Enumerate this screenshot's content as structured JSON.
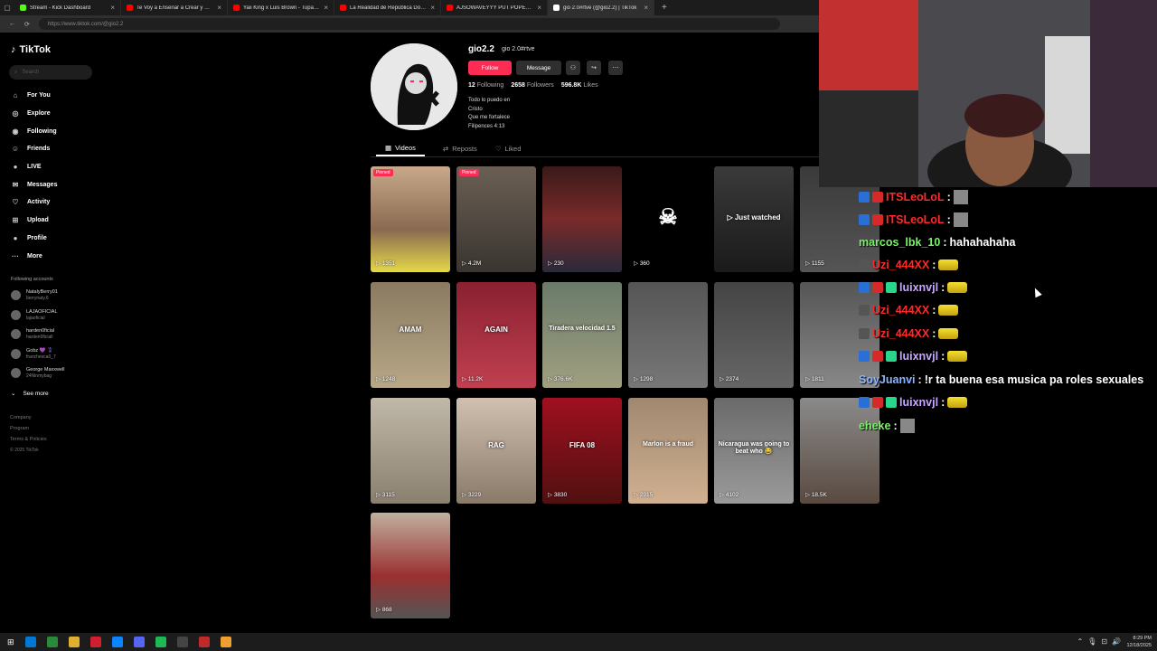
{
  "browser": {
    "tabs": [
      {
        "title": "Stream - Kick Dashboard",
        "color": "#53fc18",
        "active": false
      },
      {
        "title": "Te Voy a Enseñar a Crear y Monet",
        "color": "#ff0000",
        "active": false
      },
      {
        "title": "Yaii King x Luis Brown - Tupac (vi",
        "color": "#ff0000",
        "active": false
      },
      {
        "title": "La Realidad de República Domini",
        "color": "#ff0000",
        "active": false
      },
      {
        "title": "AJSOWAVEYYY PUT POPEROLIN",
        "color": "#ff0000",
        "active": false
      },
      {
        "title": "gio 2.0#rtve (@gio2.2) | TikTok",
        "color": "#ffffff",
        "active": true
      }
    ],
    "new_tab": "+",
    "url": "https://www.tiktok.com/@gio2.2"
  },
  "sidebar": {
    "logo": "TikTok",
    "search_placeholder": "Search",
    "nav": [
      {
        "label": "For You",
        "icon": "home-icon",
        "glyph": "⌂"
      },
      {
        "label": "Explore",
        "icon": "compass-icon",
        "glyph": "◎"
      },
      {
        "label": "Following",
        "icon": "following-icon",
        "glyph": "◉"
      },
      {
        "label": "Friends",
        "icon": "friends-icon",
        "glyph": "☺"
      },
      {
        "label": "LIVE",
        "icon": "live-icon",
        "glyph": "●"
      },
      {
        "label": "Messages",
        "icon": "messages-icon",
        "glyph": "✉"
      },
      {
        "label": "Activity",
        "icon": "activity-icon",
        "glyph": "♡"
      },
      {
        "label": "Upload",
        "icon": "upload-icon",
        "glyph": "⊞"
      },
      {
        "label": "Profile",
        "icon": "profile-icon",
        "glyph": "●"
      },
      {
        "label": "More",
        "icon": "more-icon",
        "glyph": "···"
      }
    ],
    "following_title": "Following accounts",
    "accounts": [
      {
        "name": "NatalyBerry01",
        "handle": "berrynaty.6"
      },
      {
        "name": "LAJAOFICIAL",
        "handle": "lajaoficial"
      },
      {
        "name": "harden0ficial",
        "handle": "harden0ficiall"
      },
      {
        "name": "Gobz 💜 🦹",
        "handle": "franchesca0_7"
      },
      {
        "name": "George Maxxwell",
        "handle": "24Ninmybag"
      }
    ],
    "see_more": "See more",
    "footer": [
      "Company",
      "Program",
      "Terms & Policies",
      "© 2025 TikTok"
    ]
  },
  "profile": {
    "username": "gio2.2",
    "nickname": "gio 2.0#rtve",
    "follow_label": "Follow",
    "message_label": "Message",
    "following_count": "12",
    "following_label": "Following",
    "followers_count": "2658",
    "followers_label": "Followers",
    "likes_count": "596.8K",
    "likes_label": "Likes",
    "bio": [
      "Todo lo puedo en",
      "Cristo",
      "Que me fortalece",
      "Filipences 4:13"
    ],
    "tabs": [
      "Videos",
      "Reposts",
      "Liked"
    ]
  },
  "videos": [
    {
      "views": "1351",
      "pinned": "Pinned",
      "overlay": "",
      "bg": "linear-gradient(#c9a98a,#8a6a50 60%,#e5d94a)"
    },
    {
      "views": "4.2M",
      "pinned": "Pinned",
      "overlay": "",
      "bg": "linear-gradient(#6b5f54,#3a3530)"
    },
    {
      "views": "230",
      "pinned": "",
      "overlay": "",
      "bg": "linear-gradient(#3a1a1a,#7a2a2a 50%,#2a2a3a)"
    },
    {
      "views": "360",
      "pinned": "",
      "overlay": "",
      "bg": "#000"
    },
    {
      "views": "",
      "pinned": "",
      "overlay": "▷ Just watched",
      "bg": "linear-gradient(#3a3a3a,#1a1a1a)"
    },
    {
      "views": "1155",
      "pinned": "",
      "overlay": "",
      "bg": "linear-gradient(#3a3a3a,#555)"
    },
    {
      "views": "1248",
      "pinned": "",
      "overlay": "AMAM",
      "bg": "linear-gradient(#8a7a60,#b8a888)"
    },
    {
      "views": "11.2K",
      "pinned": "",
      "overlay": "AGAIN",
      "bg": "linear-gradient(#8a2030,#c04050)"
    },
    {
      "views": "376.6K",
      "pinned": "",
      "overlay": "Tiradera velocidad 1.5",
      "bg": "linear-gradient(#6a7a6a,#a0a080)"
    },
    {
      "views": "1298",
      "pinned": "",
      "overlay": "",
      "bg": "linear-gradient(#555,#777)"
    },
    {
      "views": "2374",
      "pinned": "",
      "overlay": "",
      "bg": "linear-gradient(#444,#666)"
    },
    {
      "views": "1811",
      "pinned": "",
      "overlay": "",
      "bg": "linear-gradient(#555,#888)"
    },
    {
      "views": "3115",
      "pinned": "",
      "overlay": "",
      "bg": "linear-gradient(#c0b8a8,#8a8070)"
    },
    {
      "views": "3229",
      "pinned": "",
      "overlay": "RAG",
      "bg": "linear-gradient(#d0c0b0,#8a7a6a)"
    },
    {
      "views": "3830",
      "pinned": "",
      "overlay": "FIFA 08",
      "bg": "linear-gradient(#a01020,#501010)"
    },
    {
      "views": "2915",
      "pinned": "",
      "overlay": "Marlon is a fraud",
      "bg": "linear-gradient(#a08870,#d0b090)"
    },
    {
      "views": "4102",
      "pinned": "",
      "overlay": "Nicaragua was going to beat who 😂",
      "bg": "linear-gradient(#6a6a6a,#9a9a9a)"
    },
    {
      "views": "18.5K",
      "pinned": "",
      "overlay": "",
      "bg": "linear-gradient(#8a8a8a,#5a4a40)"
    },
    {
      "views": "868",
      "pinned": "",
      "overlay": "",
      "bg": "linear-gradient(#c0b0a0,#9a3030 60%,#555)"
    }
  ],
  "chat": [
    {
      "user": "ITSLeoLoL",
      "color": "#ff2a2a",
      "msg": "",
      "badges": [
        "#2a6fd6",
        "#d62a2a"
      ],
      "tail": "pfp"
    },
    {
      "user": "ITSLeoLoL",
      "color": "#ff2a2a",
      "msg": "",
      "badges": [
        "#2a6fd6",
        "#d62a2a"
      ],
      "tail": "pfp"
    },
    {
      "user": "marcos_lbk_10",
      "color": "#7cf06a",
      "msg": "hahahahaha",
      "badges": [],
      "tail": ""
    },
    {
      "user": "Uzi_444XX",
      "color": "#ff2a2a",
      "msg": "",
      "badges": [
        "#555"
      ],
      "tail": "emote"
    },
    {
      "user": "luixnvjl",
      "color": "#c8a8ff",
      "msg": "",
      "badges": [
        "#2a6fd6",
        "#d62a2a",
        "#2ad68a"
      ],
      "tail": "emote"
    },
    {
      "user": "Uzi_444XX",
      "color": "#ff2a2a",
      "msg": "",
      "badges": [
        "#555"
      ],
      "tail": "emote"
    },
    {
      "user": "Uzi_444XX",
      "color": "#ff2a2a",
      "msg": "",
      "badges": [
        "#555"
      ],
      "tail": "emote"
    },
    {
      "user": "luixnvjl",
      "color": "#c8a8ff",
      "msg": "",
      "badges": [
        "#2a6fd6",
        "#d62a2a",
        "#2ad68a"
      ],
      "tail": "emote"
    },
    {
      "user": "SoyJuanvi",
      "color": "#8ab4ff",
      "msg": "!r ta buena esa musica pa roles sexuales",
      "badges": [],
      "tail": ""
    },
    {
      "user": "luixnvjl",
      "color": "#c8a8ff",
      "msg": "",
      "badges": [
        "#2a6fd6",
        "#d62a2a",
        "#2ad68a"
      ],
      "tail": "emote"
    },
    {
      "user": "eheke",
      "color": "#7cf06a",
      "msg": "",
      "badges": [],
      "tail": "pfp"
    }
  ],
  "taskbar": {
    "time": "8:29 PM",
    "date": "12/18/2025",
    "apps": [
      "#0078d4",
      "#2a8a3a",
      "#e0b030",
      "#d02030",
      "#0a84ff",
      "#5865f2",
      "#1db954",
      "#444",
      "#c02a2a",
      "#f0a030"
    ]
  }
}
